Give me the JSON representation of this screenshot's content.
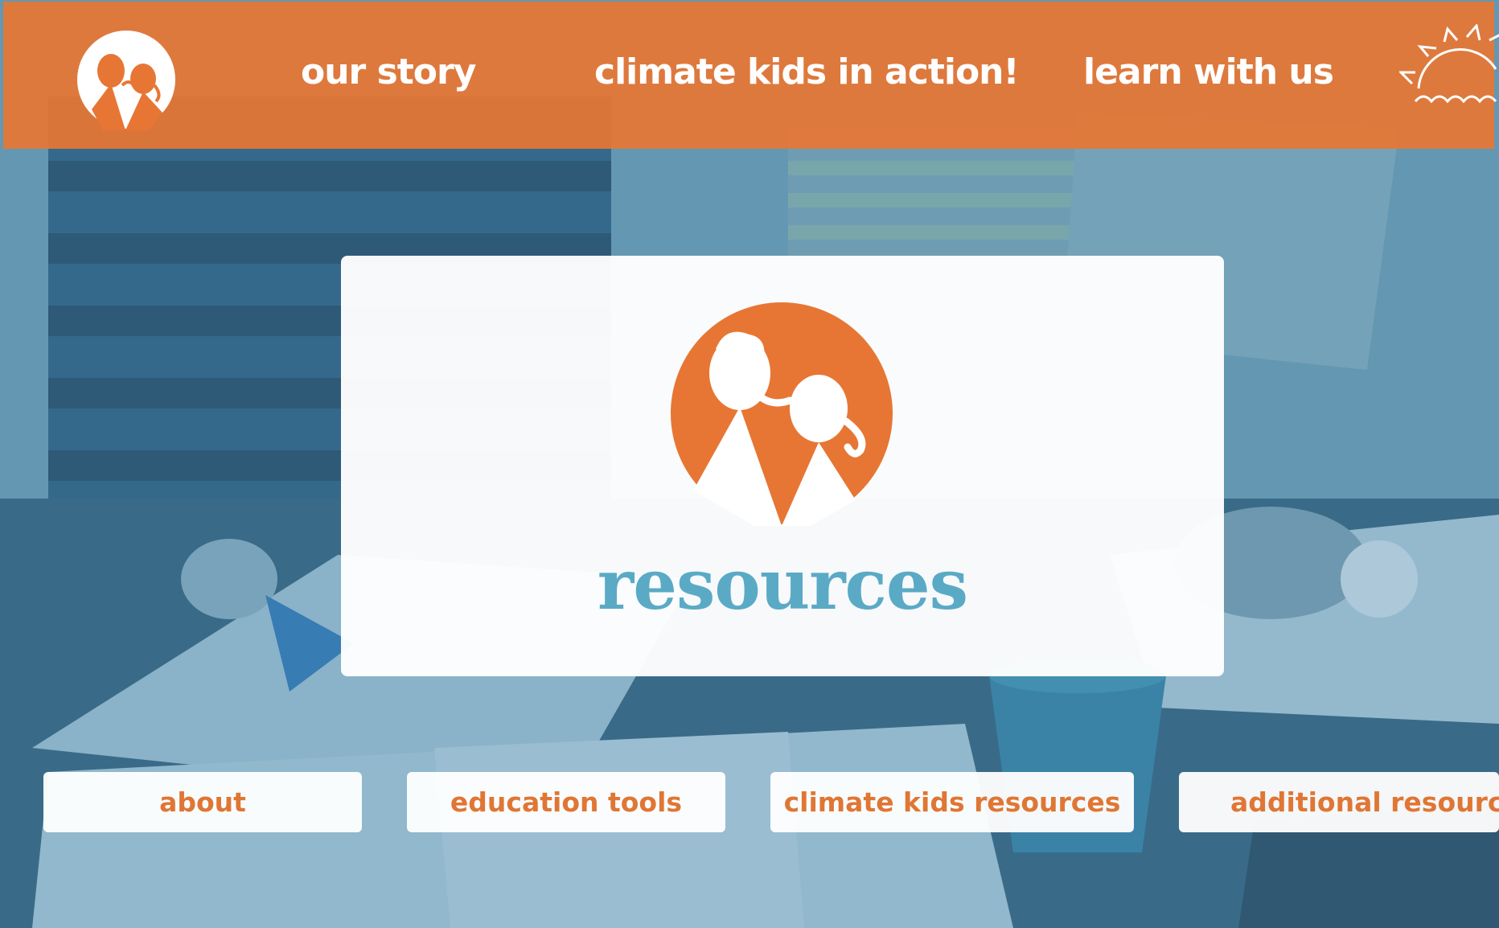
{
  "colors": {
    "brand_orange": "#e77634",
    "title_blue": "#5aaac6",
    "nav_text": "#ffffff",
    "card_bg": "#ffffff"
  },
  "header": {
    "logo_icon": "climate-kids-logo-icon",
    "nav": [
      {
        "label": "our story"
      },
      {
        "label": "climate kids in action!"
      },
      {
        "label": "learn with us"
      }
    ],
    "sun_icon": "sun-icon"
  },
  "hero": {
    "logo_icon": "climate-kids-logo-icon",
    "title": "resources"
  },
  "tabs": [
    {
      "label": "about"
    },
    {
      "label": "education tools"
    },
    {
      "label": "climate kids resources"
    },
    {
      "label": "additional resources"
    }
  ]
}
